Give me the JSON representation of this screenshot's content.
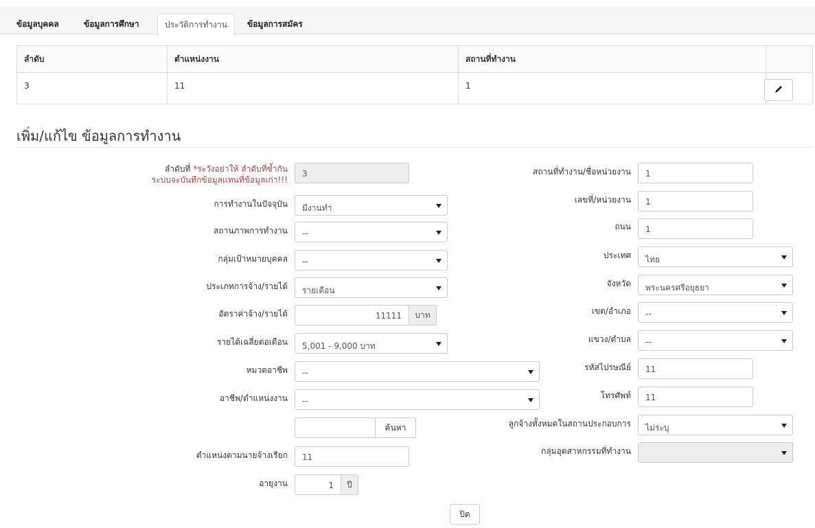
{
  "tabs": [
    "ข้อมูลบุคคล",
    "ข้อมูลการศึกษา",
    "ประวัติการทำงาน",
    "ข้อมูลการสมัคร"
  ],
  "table": {
    "headers": [
      "ลำดับ",
      "ตำแหน่งงาน",
      "สถานที่ทำงาน",
      ""
    ],
    "rows": [
      [
        "3",
        "11",
        "1"
      ]
    ]
  },
  "section_title": "เพิ่ม/แก้ไข ข้อมูลการทำงาน",
  "left": {
    "seq_label": "ลำดับที่",
    "seq_warn_1": "*ระวังอย่าให้ ลำดับที่ซ้ำกัน",
    "seq_warn_2": "ระบบจะบันทึกข้อมูลแทนที่ข้อมูลเก่า!!!",
    "seq_value": "3",
    "current_work_label": "การทำงานในปัจจุบัน",
    "current_work_value": "มีงานทำ",
    "work_status_label": "สถานภาพการทำงาน",
    "work_status_value": "--",
    "target_group_label": "กลุ่มเป้าหมายบุคคล",
    "target_group_value": "--",
    "employ_type_label": "ประเภทการจ้าง/รายได้",
    "employ_type_value": "รายเดือน",
    "wage_label": "อัตราค่าจ้าง/รายได้",
    "wage_value": "11111",
    "wage_unit": "บาท",
    "avg_income_label": "รายได้เฉลี่ยต่อเดือน",
    "avg_income_value": "5,001 - 9,000 บาท",
    "occ_category_label": "หมวดอาชีพ",
    "occ_category_value": "--",
    "occupation_label": "อาชีพ/ตำแหน่งงาน",
    "occupation_value": "--",
    "search_value": "",
    "search_button": "ค้นหา",
    "employer_title_label": "ตำแหน่งตามนายจ้างเรียก",
    "employer_title_value": "11",
    "tenure_label": "อายุงาน",
    "tenure_value": "1",
    "tenure_unit": "ปี"
  },
  "right": {
    "workplace_label": "สถานที่ทำงาน/ชื่อหน่วยงาน",
    "workplace_value": "1",
    "address_no_label": "เลขที่/หน่วยงาน",
    "address_no_value": "1",
    "road_label": "ถนน",
    "road_value": "1",
    "country_label": "ประเทศ",
    "country_value": "ไทย",
    "province_label": "จังหวัด",
    "province_value": "พระนครศรีอยุธยา",
    "district_label": "เขต/อำเภอ",
    "district_value": "--",
    "subdistrict_label": "แขวง/ตำบล",
    "subdistrict_value": "--",
    "postcode_label": "รหัสไปรษณีย์",
    "postcode_value": "11",
    "phone_label": "โทรศัพท์",
    "phone_value": "11",
    "employees_label": "ลูกจ้างทั้งหมดในสถานประกอบการ",
    "employees_value": "ไม่ระบุ",
    "industry_label": "กลุ่มอุตสาหกรรมที่ทำงาน",
    "industry_value": ""
  },
  "close_button": "ปิด"
}
